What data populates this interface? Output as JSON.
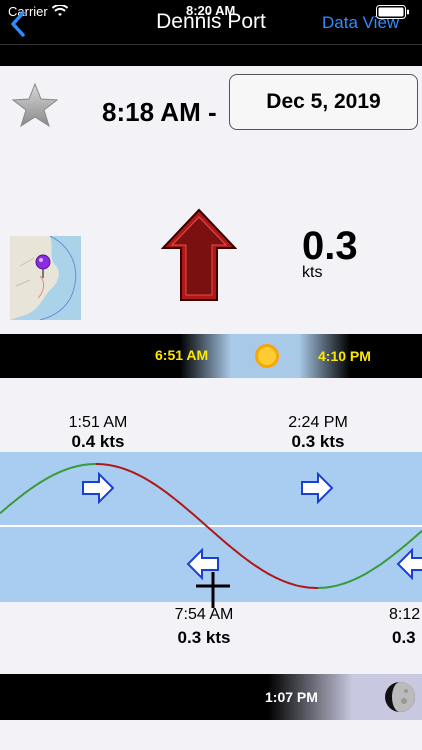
{
  "status": {
    "carrier": "Carrier",
    "time": "8:20 AM"
  },
  "nav": {
    "title": "Dennis Port",
    "right_action": "Data View"
  },
  "current": {
    "time_label": "8:18 AM -",
    "date": "Dec 5, 2019",
    "speed": "0.3",
    "unit": "kts",
    "direction": "flood"
  },
  "sun": {
    "sunrise": "6:51 AM",
    "sunset": "4:10 PM"
  },
  "tide": {
    "events": [
      {
        "time": "1:51 AM",
        "speed": "0.4 kts"
      },
      {
        "time": "2:24 PM",
        "speed": "0.3 kts"
      },
      {
        "time": "7:54 AM",
        "speed": "0.3 kts"
      },
      {
        "time": "8:12",
        "speed": "0.3"
      }
    ]
  },
  "moon": {
    "moonrise": "1:07 PM"
  },
  "colors": {
    "flood": "#3a9a3a",
    "ebb": "#b01818",
    "chart_bg": "#a8cdf0",
    "arrow": "#7a1010"
  }
}
